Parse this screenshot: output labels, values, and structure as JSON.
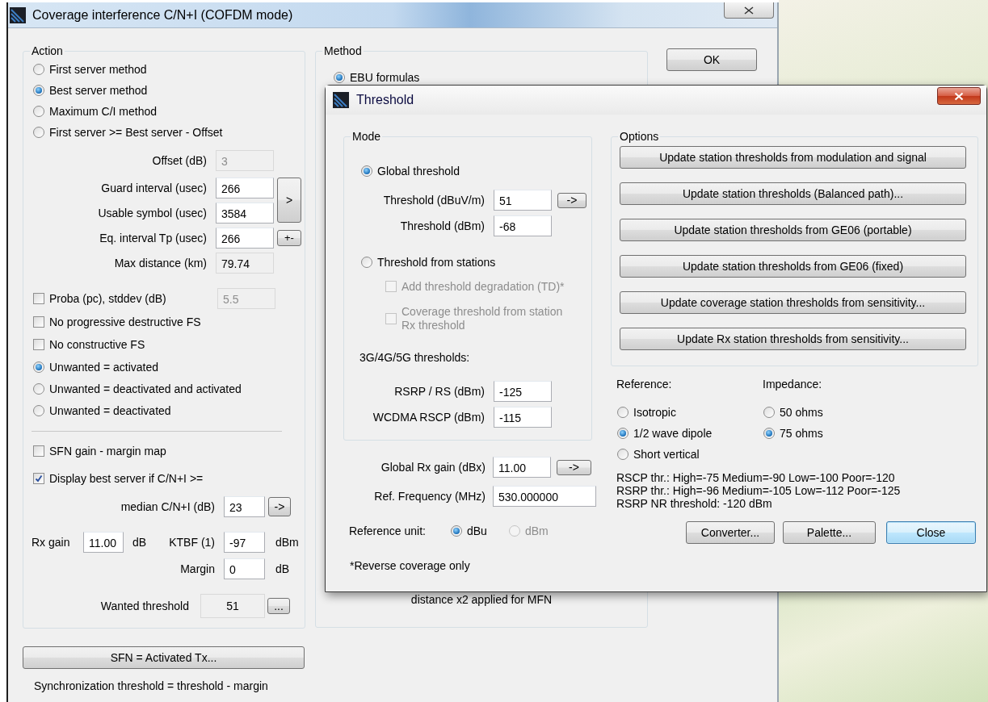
{
  "main_window": {
    "title": "Coverage interference C/N+I (COFDM mode)",
    "action": {
      "title": "Action",
      "methods": [
        {
          "label": "First server method",
          "selected": false
        },
        {
          "label": "Best server method",
          "selected": true
        },
        {
          "label": "Maximum C/I method",
          "selected": false
        },
        {
          "label": "First server >= Best server - Offset",
          "selected": false
        }
      ],
      "offset": {
        "label": "Offset (dB)",
        "value": "3",
        "disabled": true
      },
      "timing": [
        {
          "label": "Guard interval (usec)",
          "value": "266",
          "readonly": false
        },
        {
          "label": "Usable symbol (usec)",
          "value": "3584",
          "readonly": false
        },
        {
          "label": "Eq. interval Tp (usec)",
          "value": "266",
          "readonly": false
        },
        {
          "label": "Max distance (km)",
          "value": "79.74",
          "readonly": true
        }
      ],
      "compute_button": ">",
      "plus_minus_button": "+-",
      "proba": {
        "label": "Proba (pc), stddev (dB)",
        "checked": false,
        "value": "5.5",
        "disabled": true
      },
      "fs_options": [
        {
          "label": "No progressive destructive FS",
          "checked": false
        },
        {
          "label": "No constructive FS",
          "checked": false
        }
      ],
      "unwanted": [
        {
          "label": "Unwanted = activated",
          "selected": true
        },
        {
          "label": "Unwanted = deactivated and activated",
          "selected": false
        },
        {
          "label": "Unwanted = deactivated",
          "selected": false
        }
      ],
      "sfn_gain": {
        "label": "SFN gain - margin map",
        "checked": false
      },
      "display_best": {
        "label": "Display best server if C/N+I >=",
        "checked": true
      },
      "median": {
        "label": "median C/N+I (dB)",
        "value": "23",
        "button": "->"
      },
      "rx_gain": {
        "label": "Rx gain",
        "value": "11.00",
        "unit": "dB"
      },
      "ktbf": {
        "label": "KTBF (1)",
        "value": "-97",
        "unit": "dBm"
      },
      "margin": {
        "label": "Margin",
        "value": "0",
        "unit": "dB"
      },
      "wanted": {
        "label": "Wanted threshold",
        "value": "51",
        "button": "..."
      }
    },
    "sfn_button": "SFN = Activated Tx...",
    "sync_note": "Synchronization threshold = threshold - margin",
    "method": {
      "title": "Method",
      "options": [
        {
          "label": "EBU formulas",
          "selected": true
        }
      ],
      "note": "distance x2 applied for MFN"
    },
    "ok_button": "OK"
  },
  "threshold_dialog": {
    "title": "Threshold",
    "mode": {
      "title": "Mode",
      "global": {
        "label": "Global threshold",
        "selected": true
      },
      "fields": [
        {
          "label": "Threshold (dBuV/m)",
          "value": "51",
          "button": "->"
        },
        {
          "label": "Threshold (dBm)",
          "value": "-68"
        }
      ],
      "from_stations": {
        "label": "Threshold from stations",
        "selected": false
      },
      "station_options": [
        {
          "label": "Add threshold degradation (TD)*",
          "checked": false,
          "disabled": true
        },
        {
          "label": "Coverage threshold from station Rx threshold",
          "checked": false,
          "disabled": true
        }
      ],
      "subtitle": "3G/4G/5G thresholds:",
      "g_fields": [
        {
          "label": "RSRP / RS (dBm)",
          "value": "-125"
        },
        {
          "label": "WCDMA RSCP (dBm)",
          "value": "-115"
        }
      ]
    },
    "rx_gain": {
      "label": "Global Rx gain (dBx)",
      "value": "11.00",
      "button": "->"
    },
    "ref_freq": {
      "label": "Ref. Frequency (MHz)",
      "value": "530.000000"
    },
    "ref_unit": {
      "label": "Reference unit:",
      "options": [
        {
          "label": "dBu",
          "selected": true,
          "disabled": false
        },
        {
          "label": "dBm",
          "selected": false,
          "disabled": true
        }
      ]
    },
    "footnote": "*Reverse coverage only",
    "options": {
      "title": "Options",
      "buttons": [
        "Update station thresholds from modulation and signal",
        "Update station thresholds (Balanced path)...",
        "Update station thresholds from GE06 (portable)",
        "Update station thresholds from GE06 (fixed)",
        "Update coverage station thresholds from sensitivity...",
        "Update Rx station thresholds from sensitivity..."
      ]
    },
    "reference": {
      "label": "Reference:",
      "options": [
        {
          "label": "Isotropic",
          "selected": false
        },
        {
          "label": "1/2 wave dipole",
          "selected": true
        },
        {
          "label": "Short vertical",
          "selected": false
        }
      ]
    },
    "impedance": {
      "label": "Impedance:",
      "options": [
        {
          "label": "50 ohms",
          "selected": false
        },
        {
          "label": "75 ohms",
          "selected": true
        }
      ]
    },
    "info": [
      "RSCP thr.: High=-75 Medium=-90 Low=-100 Poor=-120",
      "RSRP thr.: High=-96 Medium=-105 Low=-112 Poor=-125",
      "RSRP NR threshold: -120 dBm"
    ],
    "buttons": [
      {
        "label": "Converter...",
        "default": false
      },
      {
        "label": "Palette...",
        "default": false
      },
      {
        "label": "Close",
        "default": true
      }
    ]
  }
}
